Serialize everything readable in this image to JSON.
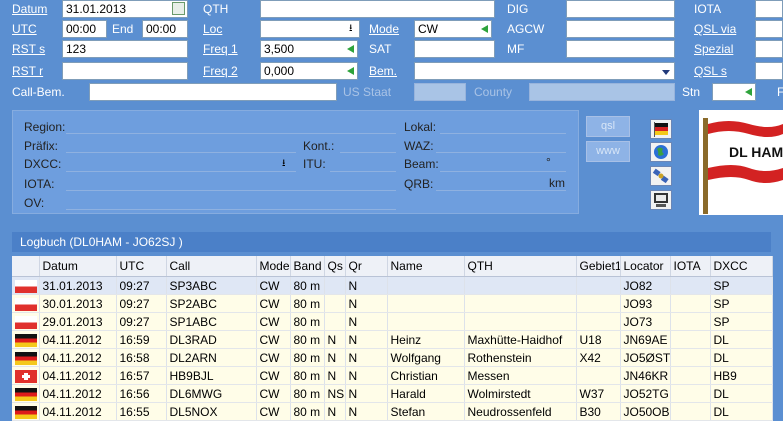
{
  "form": {
    "datum_label": "Datum",
    "datum_value": "31.01.2013",
    "utc_label": "UTC",
    "utc_value": "00:00",
    "end_label": "End",
    "end_value": "00:00",
    "rst_s_label": "RST s",
    "rst_s_value": "123",
    "rst_r_label": "RST r",
    "rst_r_value": "",
    "callbem_label": "Call-Bem.",
    "callbem_value": "",
    "qth_label": "QTH",
    "qth_value": "",
    "loc_label": "Loc",
    "loc_value": "",
    "freq1_label": "Freq 1",
    "freq1_value": "3,500",
    "freq2_label": "Freq 2",
    "freq2_value": "0,000",
    "us_staat_label": "US Staat",
    "mode_label": "Mode",
    "mode_value": "CW",
    "sat_label": "SAT",
    "sat_value": "",
    "bem_label": "Bem.",
    "bem_value": "",
    "county_label": "County",
    "dig_label": "DIG",
    "dig_value": "",
    "agcw_label": "AGCW",
    "agcw_value": "",
    "mf_label": "MF",
    "mf_value": "",
    "iota_label": "IOTA",
    "iota_value": "",
    "qslvia_label": "QSL via",
    "qslvia_value": "",
    "spezial_label": "Spezial",
    "spezial_value": "",
    "qsls_label": "QSL s",
    "qsls_value": "",
    "stn_label": "Stn",
    "stn_value": "",
    "f_label": "F"
  },
  "info": {
    "region": "Region:",
    "praefix": "Präfix:",
    "dxcc": "DXCC:",
    "iota": "IOTA:",
    "ov": "OV:",
    "kont": "Kont.:",
    "itu": "ITU:",
    "lokal": "Lokal:",
    "waz": "WAZ:",
    "beam": "Beam:",
    "beam_unit": "°",
    "qrb": "QRB:",
    "qrb_unit": "km"
  },
  "buttons": {
    "qsl": "qsl",
    "www": "www"
  },
  "logo_text": "DL HAM",
  "icons": [
    "flag-icon",
    "globe-icon",
    "satellite-icon",
    "computer-icon"
  ],
  "logbook": {
    "title": "Logbuch  (DL0HAM - JO62SJ )",
    "columns": [
      "",
      "Datum",
      "UTC",
      "Call",
      "Mode",
      "Band",
      "Qs",
      "Qr",
      "Name",
      "QTH",
      "Gebiet1",
      "Locator",
      "IOTA",
      "DXCC"
    ],
    "rows": [
      {
        "flag": "pl",
        "datum": "31.01.2013",
        "utc": "09:27",
        "call": "SP3ABC",
        "mode": "CW",
        "band": "80 m",
        "qs": "",
        "qr": "N",
        "name": "",
        "qth": "",
        "gebiet": "",
        "locator": "JO82",
        "iota": "",
        "dxcc": "SP"
      },
      {
        "flag": "pl",
        "datum": "30.01.2013",
        "utc": "09:27",
        "call": "SP2ABC",
        "mode": "CW",
        "band": "80 m",
        "qs": "",
        "qr": "N",
        "name": "",
        "qth": "",
        "gebiet": "",
        "locator": "JO93",
        "iota": "",
        "dxcc": "SP"
      },
      {
        "flag": "pl",
        "datum": "29.01.2013",
        "utc": "09:27",
        "call": "SP1ABC",
        "mode": "CW",
        "band": "80 m",
        "qs": "",
        "qr": "N",
        "name": "",
        "qth": "",
        "gebiet": "",
        "locator": "JO73",
        "iota": "",
        "dxcc": "SP"
      },
      {
        "flag": "de",
        "datum": "04.11.2012",
        "utc": "16:59",
        "call": "DL3RAD",
        "mode": "CW",
        "band": "80 m",
        "qs": "N",
        "qr": "N",
        "name": "Heinz",
        "qth": "Maxhütte-Haidhof",
        "gebiet": "U18",
        "locator": "JN69AE",
        "iota": "",
        "dxcc": "DL"
      },
      {
        "flag": "de",
        "datum": "04.11.2012",
        "utc": "16:58",
        "call": "DL2ARN",
        "mode": "CW",
        "band": "80 m",
        "qs": "N",
        "qr": "N",
        "name": "Wolfgang",
        "qth": "Rothenstein",
        "gebiet": "X42",
        "locator": "JO5ØST",
        "iota": "",
        "dxcc": "DL"
      },
      {
        "flag": "ch",
        "datum": "04.11.2012",
        "utc": "16:57",
        "call": "HB9BJL",
        "mode": "CW",
        "band": "80 m",
        "qs": "N",
        "qr": "N",
        "name": "Christian",
        "qth": "Messen",
        "gebiet": "",
        "locator": "JN46KR",
        "iota": "",
        "dxcc": "HB9"
      },
      {
        "flag": "de",
        "datum": "04.11.2012",
        "utc": "16:56",
        "call": "DL6MWG",
        "mode": "CW",
        "band": "80 m",
        "qs": "NS",
        "qr": "N",
        "name": "Harald",
        "qth": "Wolmirstedt",
        "gebiet": "W37",
        "locator": "JO52TG",
        "iota": "",
        "dxcc": "DL"
      },
      {
        "flag": "de",
        "datum": "04.11.2012",
        "utc": "16:55",
        "call": "DL5NOX",
        "mode": "CW",
        "band": "80 m",
        "qs": "N",
        "qr": "N",
        "name": "Stefan",
        "qth": "Neudrossenfeld",
        "gebiet": "B30",
        "locator": "JO50OB",
        "iota": "",
        "dxcc": "DL"
      }
    ]
  },
  "colors": {
    "background": "#5b8fd1",
    "panel": "#6e9ede",
    "accent_green": "#2ea33b",
    "row_selected": "#dfe7f5",
    "grid_bg": "#fffde8"
  }
}
